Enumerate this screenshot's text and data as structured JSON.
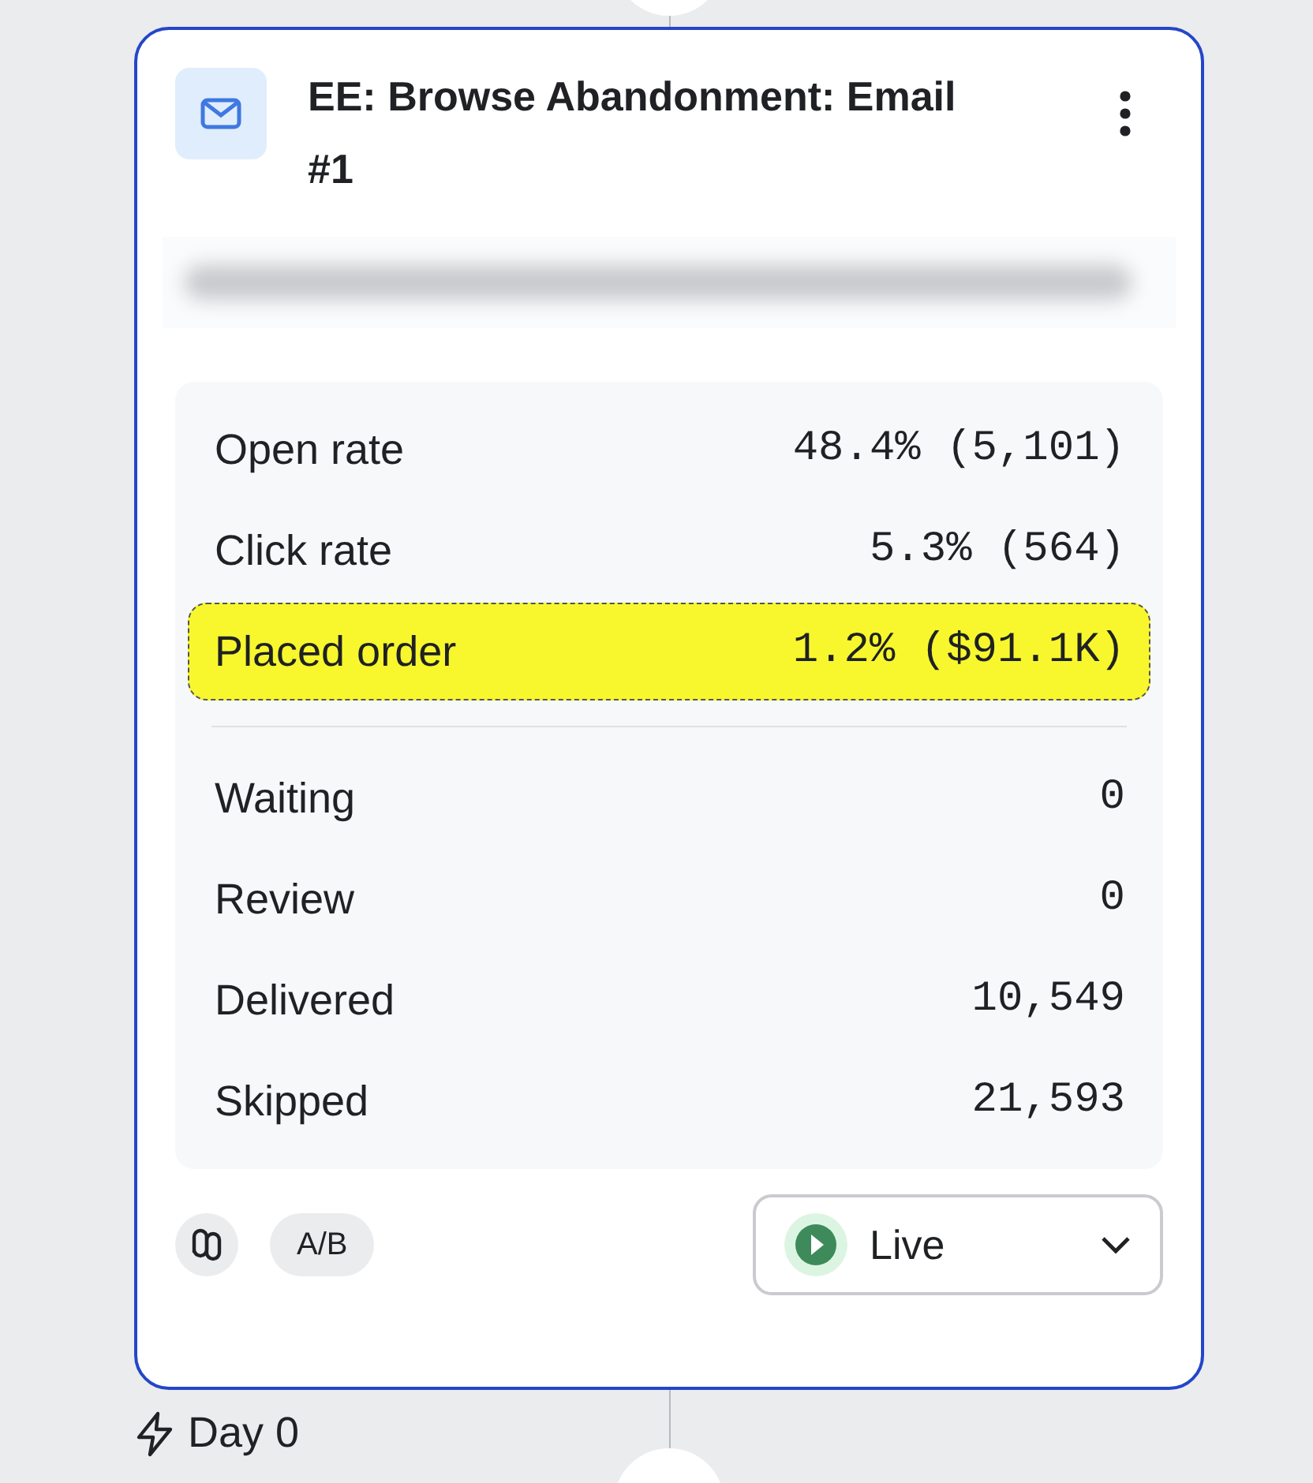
{
  "card": {
    "title": "EE: Browse Abandonment: Email #1",
    "metrics": [
      {
        "label": "Open rate",
        "value": "48.4% (5,101)",
        "highlighted": false
      },
      {
        "label": "Click rate",
        "value": "5.3% (564)",
        "highlighted": false
      },
      {
        "label": "Placed order",
        "value": "1.2% ($91.1K)",
        "highlighted": true
      }
    ],
    "counts": [
      {
        "label": "Waiting",
        "value": "0"
      },
      {
        "label": "Review",
        "value": "0"
      },
      {
        "label": "Delivered",
        "value": "10,549"
      },
      {
        "label": "Skipped",
        "value": "21,593"
      }
    ],
    "ab_badge": "A/B",
    "status": {
      "label": "Live"
    }
  },
  "trigger": {
    "label": "Day 0"
  }
}
